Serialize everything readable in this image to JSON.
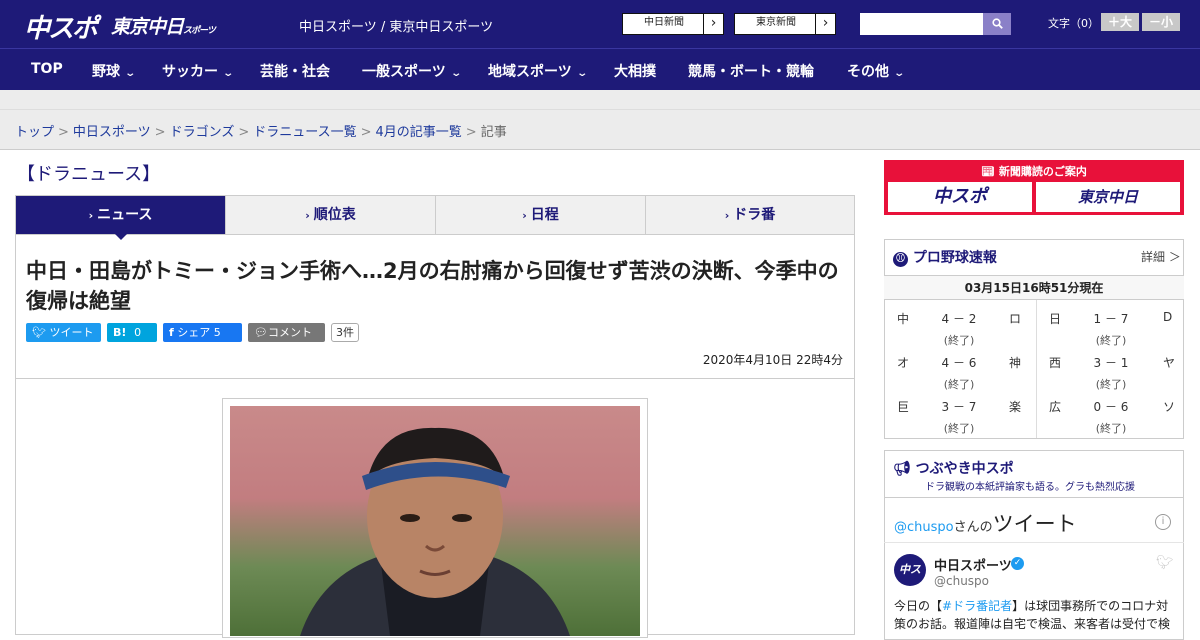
{
  "header": {
    "logo_primary": "中スポ",
    "logo_secondary": "東京中日",
    "logo_secondary_small": "スポーツ",
    "site_links": "中日スポーツ / 東京中日スポーツ",
    "sister_sites": [
      "中日新聞",
      "東京新聞"
    ],
    "search_placeholder": "",
    "font_size_label": "文字（0）",
    "font_larger": "＋大",
    "font_smaller": "－小"
  },
  "nav": {
    "items": [
      {
        "label": "TOP",
        "has_menu": false
      },
      {
        "label": "野球",
        "has_menu": true
      },
      {
        "label": "サッカー",
        "has_menu": true
      },
      {
        "label": "芸能・社会",
        "has_menu": false
      },
      {
        "label": "一般スポーツ",
        "has_menu": true
      },
      {
        "label": "地域スポーツ",
        "has_menu": true
      },
      {
        "label": "大相撲",
        "has_menu": false
      },
      {
        "label": "競馬・ボート・競輪",
        "has_menu": false
      },
      {
        "label": "その他",
        "has_menu": true
      }
    ]
  },
  "breadcrumb": {
    "items": [
      "トップ",
      "中日スポーツ",
      "ドラゴンズ",
      "ドラニュース一覧",
      "4月の記事一覧"
    ],
    "current": "記事"
  },
  "section": {
    "title": "【ドラニュース】",
    "tabs": [
      "ニュース",
      "順位表",
      "日程",
      "ドラ番"
    ],
    "active_tab": 0
  },
  "article": {
    "headline": "中日・田島がトミー・ジョン手術へ…2月の右肘痛から回復せず苦渋の決断、今季中の復帰は絶望",
    "share": {
      "tweet": "ツイート",
      "hatena": "B!",
      "hatena_count": "0",
      "facebook": "シェア",
      "facebook_count": "5",
      "comment": "コメント",
      "comment_count": "3件"
    },
    "date": "2020年4月10日 22時4分"
  },
  "sidebar": {
    "subscription": {
      "title": "新聞購読のご案内",
      "logos": [
        "中スポ",
        "東京中日"
      ]
    },
    "scores": {
      "title": "プロ野球速報",
      "detail": "詳細 ＞",
      "timestamp": "03月15日16時51分現在",
      "games": [
        {
          "home": "中",
          "score": "4 － 2",
          "away": "ロ",
          "status": "(終了)"
        },
        {
          "home": "日",
          "score": "1 － 7",
          "away": "D",
          "status": "(終了)"
        },
        {
          "home": "オ",
          "score": "4 － 6",
          "away": "神",
          "status": "(終了)"
        },
        {
          "home": "西",
          "score": "3 － 1",
          "away": "ヤ",
          "status": "(終了)"
        },
        {
          "home": "巨",
          "score": "3 － 7",
          "away": "楽",
          "status": "(終了)"
        },
        {
          "home": "広",
          "score": "0 － 6",
          "away": "ソ",
          "status": "(終了)"
        }
      ]
    },
    "twitter": {
      "title": "つぶやき中スポ",
      "subtitle": "ドラ観戦の本紙評論家も語る。グラも熱烈応援",
      "account_link": "@chuspo",
      "account_suffix": "さんの",
      "widget_title": "ツイート",
      "name": "中日スポーツ",
      "handle": "@chuspo",
      "avatar_text": "中スポ",
      "text_pre": "今日の【",
      "text_tag": "#ドラ番記者",
      "text_post": "】は球団事務所でのコロナ対策のお話。報道陣は自宅で検温、来客者は受付で検"
    }
  },
  "colors": {
    "brand_navy": "#1e1a78",
    "subscription_red": "#e8113a",
    "twitter_blue": "#1d9bf0",
    "hatena_blue": "#00a4de",
    "facebook_blue": "#1877f2",
    "comment_gray": "#777777"
  }
}
